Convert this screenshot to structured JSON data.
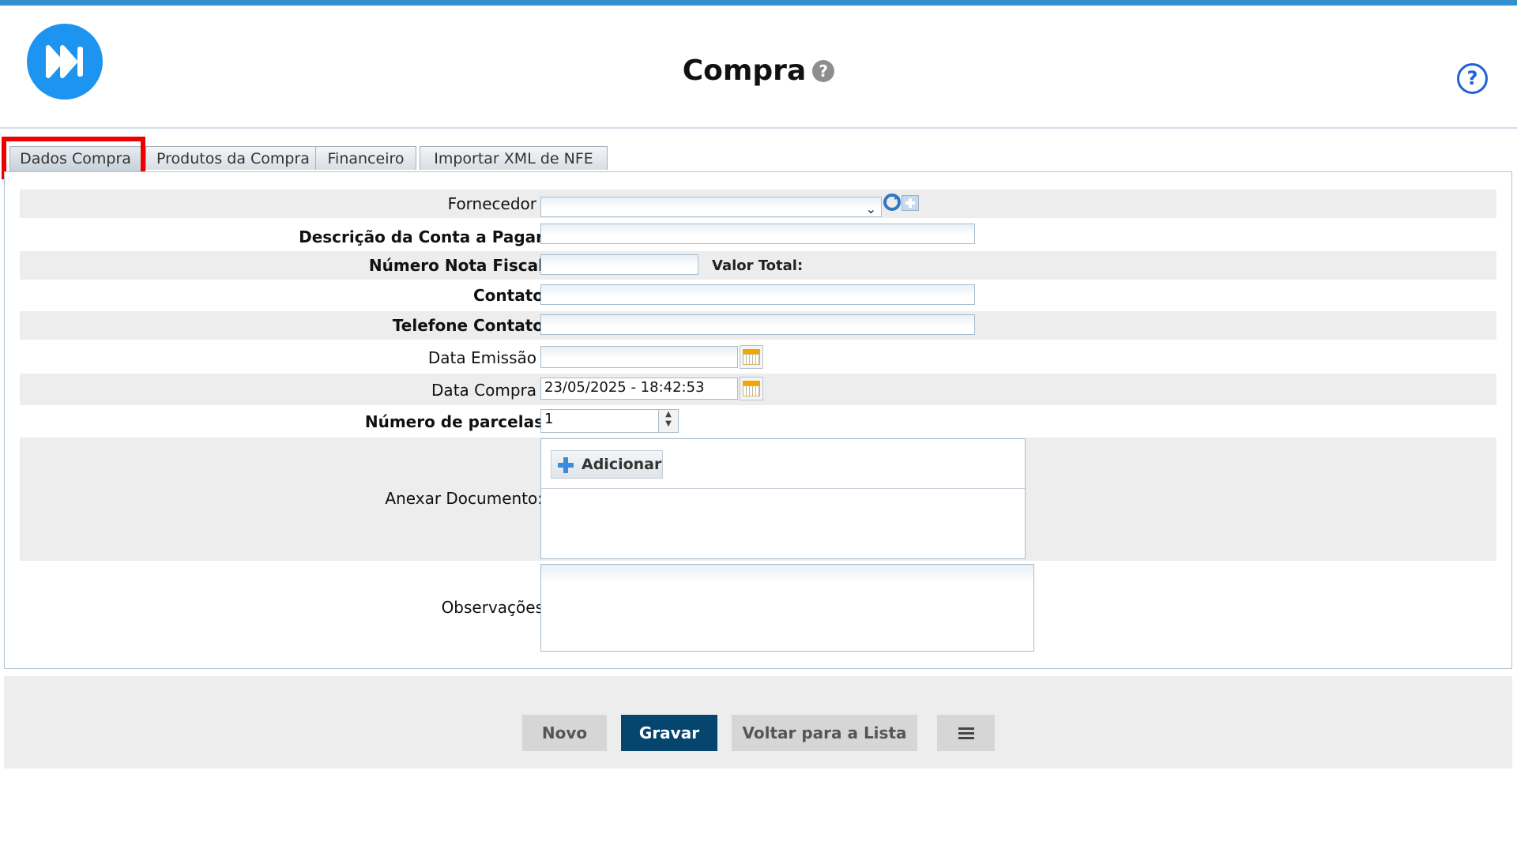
{
  "header": {
    "title": "Compra",
    "title_help_glyph": "?",
    "help_glyph": "?"
  },
  "tabs": [
    {
      "label": "Dados Compra",
      "active": true
    },
    {
      "label": "Produtos da Compra",
      "active": false
    },
    {
      "label": "Financeiro",
      "active": false
    },
    {
      "label": "Importar XML de NFE",
      "active": false
    }
  ],
  "form": {
    "fornecedor": {
      "label": "Fornecedor",
      "value": ""
    },
    "descricao": {
      "label": "Descrição da Conta a Pagar",
      "value": ""
    },
    "nota_fiscal": {
      "label": "Número Nota Fiscal",
      "value": "",
      "valor_total_label": "Valor Total:"
    },
    "contato": {
      "label": "Contato",
      "value": ""
    },
    "telefone": {
      "label": "Telefone Contato",
      "value": ""
    },
    "data_emissao": {
      "label": "Data Emissão",
      "value": ""
    },
    "data_compra": {
      "label": "Data Compra",
      "value": "23/05/2025 - 18:42:53"
    },
    "parcelas": {
      "label": "Número de parcelas",
      "value": "1"
    },
    "anexar": {
      "label": "Anexar Documento:",
      "add_label": "Adicionar"
    },
    "observacoes": {
      "label": "Observações",
      "value": ""
    }
  },
  "footer": {
    "novo_label": "Novo",
    "gravar_label": "Gravar",
    "voltar_label": "Voltar para a Lista",
    "list_icon": "list-icon"
  },
  "colors": {
    "top_bar": "#3291cc",
    "logo": "#1d94f0",
    "primary_button": "#06466e",
    "highlight": "#ee0000",
    "help_icon": "#1e62d8"
  }
}
